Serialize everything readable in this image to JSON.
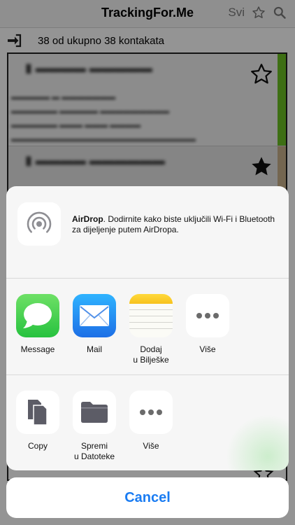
{
  "app": {
    "title": "TrackingFor.Me",
    "filter_label": "Svi",
    "count_text": "38 od ukupno 38 kontakata"
  },
  "share_sheet": {
    "airdrop": {
      "title": "AirDrop",
      "description": ". Dodirnite kako biste uključili Wi-Fi i Bluetooth za dijeljenje putem AirDropa."
    },
    "apps": [
      {
        "label": "Message",
        "icon": "messages-icon"
      },
      {
        "label": "Mail",
        "icon": "mail-icon"
      },
      {
        "label": "Dodaj\nu Bilješke",
        "icon": "notes-icon"
      },
      {
        "label": "Više",
        "icon": "more-icon"
      }
    ],
    "actions": [
      {
        "label": "Copy",
        "icon": "copy-icon"
      },
      {
        "label": "Spremi\nu Datoteke",
        "icon": "folder-icon"
      },
      {
        "label": "Više",
        "icon": "more-icon"
      }
    ],
    "cancel_label": "Cancel"
  },
  "colors": {
    "accent": "#1a7cf2",
    "status_green": "#6cc024",
    "status_tan": "#c9b08a"
  }
}
